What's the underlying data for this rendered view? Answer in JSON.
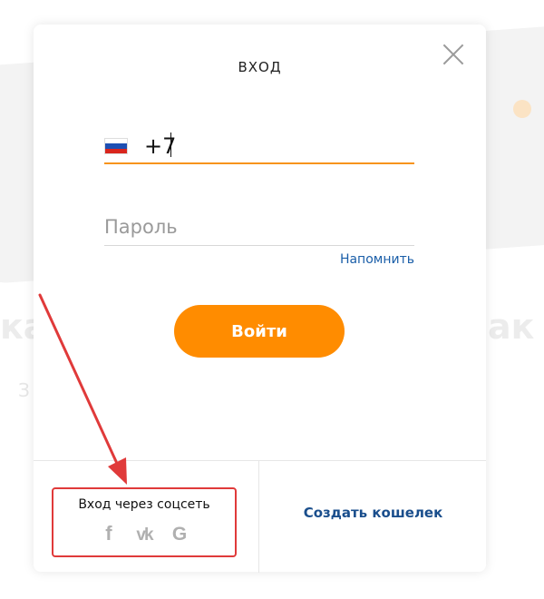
{
  "modal": {
    "title": "ВХОД",
    "phone": {
      "value": "+7"
    },
    "password": {
      "placeholder": "Пароль"
    },
    "remind_label": "Напомнить",
    "login_label": "Войти",
    "social": {
      "label": "Вход через соцсеть",
      "icons": [
        {
          "name": "facebook-icon",
          "glyph": "f"
        },
        {
          "name": "vk-icon",
          "glyph": "vk"
        },
        {
          "name": "google-icon",
          "glyph": "G"
        }
      ]
    },
    "create_wallet_label": "Создать кошелек"
  },
  "colors": {
    "accent": "#ff8c00",
    "link": "#1a5ea8",
    "annotation": "#e03a3a"
  }
}
